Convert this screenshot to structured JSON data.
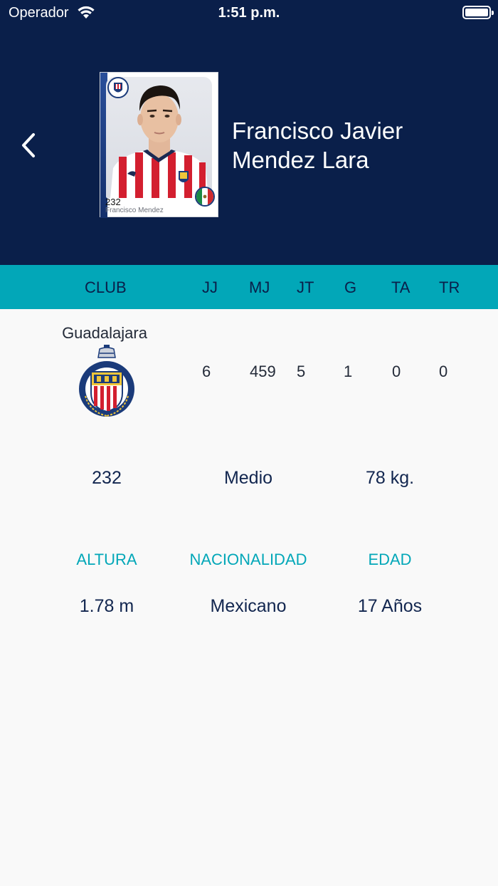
{
  "status_bar": {
    "carrier": "Operador",
    "time": "1:51 p.m.",
    "battery_level": 1.0
  },
  "header": {
    "player_name_line1": "Francisco Javier",
    "player_name_line2": "Mendez Lara",
    "card": {
      "number": "232",
      "name": "Francisco Mendez"
    }
  },
  "stats": {
    "headers": {
      "club": "CLUB",
      "jj": "JJ",
      "mj": "MJ",
      "jt": "JT",
      "g": "G",
      "ta": "TA",
      "tr": "TR"
    },
    "club_name": "Guadalajara",
    "values": {
      "jj": "6",
      "mj": "459",
      "jt": "5",
      "g": "1",
      "ta": "0",
      "tr": "0"
    }
  },
  "profile": {
    "number": "232",
    "position": "Medio",
    "weight": "78 kg.",
    "labels": {
      "height": "ALTURA",
      "nationality": "NACIONALIDAD",
      "age": "EDAD"
    },
    "height": "1.78 m",
    "nationality": "Mexicano",
    "age": "17 Años"
  },
  "colors": {
    "header_bg": "#0a1f4a",
    "accent": "#02a7b8",
    "text_dark": "#12264f",
    "page_bg": "#f9f9f9"
  },
  "icons": {
    "back": "chevron-left-icon",
    "wifi": "wifi-icon",
    "battery": "battery-icon",
    "club_logo": "club-crest-icon"
  }
}
